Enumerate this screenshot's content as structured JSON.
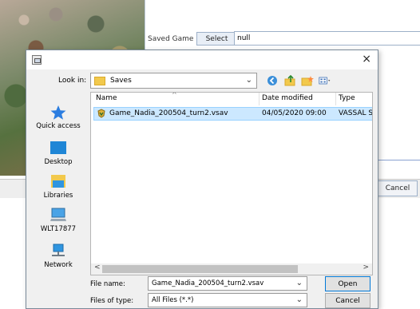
{
  "background": {
    "saved_game_label": "Saved Game",
    "select_button": "Select",
    "saved_game_value": "null",
    "cancel_button": "Cancel"
  },
  "dialog": {
    "close_glyph": "×",
    "look_in_label": "Look in:",
    "look_in_value": "Saves",
    "places": [
      {
        "label": "Quick access",
        "icon": "star-icon"
      },
      {
        "label": "Desktop",
        "icon": "desktop-icon"
      },
      {
        "label": "Libraries",
        "icon": "libraries-icon"
      },
      {
        "label": "WLT17877",
        "icon": "computer-icon"
      },
      {
        "label": "Network",
        "icon": "network-icon"
      }
    ],
    "columns": {
      "name": "Name",
      "date": "Date modified",
      "type": "Type"
    },
    "files": [
      {
        "name": "Game_Nadia_200504_turn2.vsav",
        "date": "04/05/2020 09:00",
        "type": "VASSAL Sa"
      }
    ],
    "file_name_label": "File name:",
    "file_name_value": "Game_Nadia_200504_turn2.vsav",
    "file_type_label": "Files of type:",
    "file_type_value": "All Files (*.*)",
    "open_button": "Open",
    "cancel_button": "Cancel"
  }
}
